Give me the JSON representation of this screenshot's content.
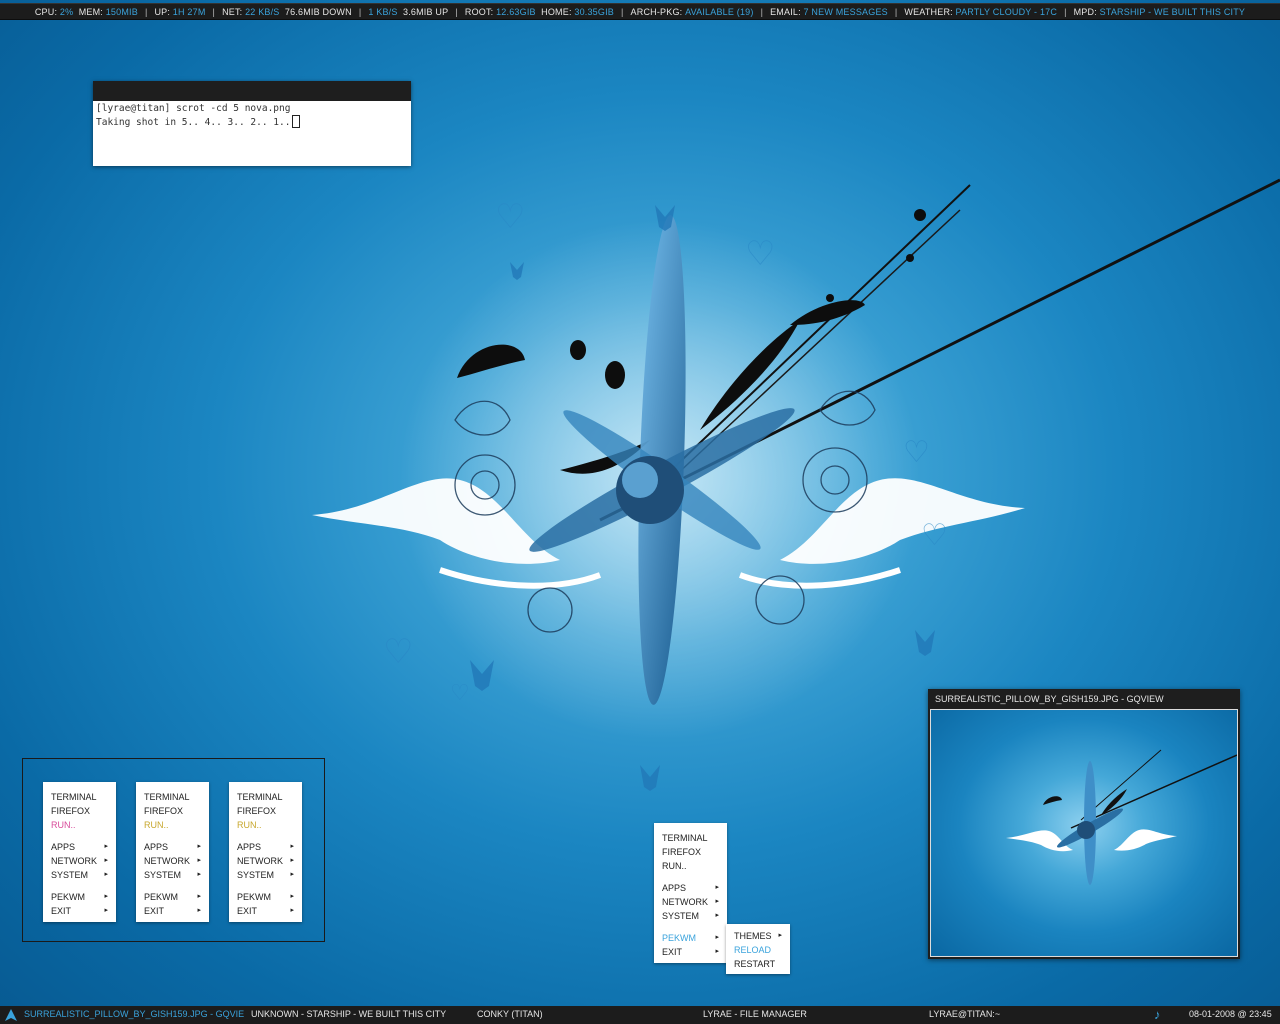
{
  "topbar": {
    "cpu_label": "CPU:",
    "cpu": "2%",
    "mem_label": "MEM:",
    "mem": "150MIB",
    "up_label": "UP:",
    "up": "1H 27M",
    "net_label": "NET:",
    "net_down_rate": "22 KB/S",
    "net_down": "76.6MIB DOWN",
    "net_up_rate": "1 KB/S",
    "net_up": "3.6MIB UP",
    "root_label": "ROOT:",
    "root": "12.63GIB",
    "home_label": "HOME:",
    "home": "30.35GIB",
    "arch_label": "ARCH-PKG:",
    "arch": "AVAILABLE (19)",
    "email_label": "EMAIL:",
    "email": "7 NEW MESSAGES",
    "weather_label": "WEATHER:",
    "weather": "PARTLY CLOUDY - 17C",
    "mpd_label": "MPD:",
    "mpd": "STARSHIP - WE BUILT THIS CITY",
    "separator": "|"
  },
  "terminal": {
    "line1": "[lyrae@titan] scrot -cd 5 nova.png",
    "line2": "Taking shot in 5.. 4.. 3.. 2.. 1.."
  },
  "menu": {
    "terminal": "TERMINAL",
    "firefox": "FIREFOX",
    "run": "RUN..",
    "apps": "APPS",
    "network": "NETWORK",
    "system": "SYSTEM",
    "pekwm": "PEKWM",
    "exit": "EXIT",
    "arrow": "▸"
  },
  "submenu": {
    "themes": "THEMES",
    "reload": "RELOAD",
    "restart": "RESTART"
  },
  "gqview": {
    "title": "SURREALISTIC_PILLOW_BY_GISH159.JPG - GQVIEW"
  },
  "taskbar": {
    "task1": "SURREALISTIC_PILLOW_BY_GISH159.JPG - GQVIE",
    "task2": "UNKNOWN - STARSHIP - WE BUILT THIS CITY",
    "task3": "CONKY (TITAN)",
    "task4": "LYRAE - FILE MANAGER",
    "task5": "LYRAE@TITAN:~",
    "music_glyph": "♪",
    "clock": "08-01-2008 @ 23:45"
  },
  "colors": {
    "accent": "#3aa3dc",
    "bar": "#1c1c1c",
    "pink": "#d84a9a",
    "yellow": "#c7a72c"
  }
}
